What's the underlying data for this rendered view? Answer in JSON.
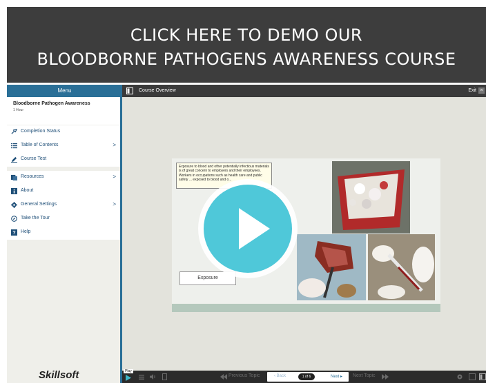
{
  "banner": {
    "line1": "CLICK HERE TO DEMO OUR",
    "line2": "BLOODBORNE PATHOGENS AWARENESS COURSE"
  },
  "sidebar": {
    "header": "Menu",
    "course_title": "Bloodborne Pathogen Awareness",
    "course_duration": "1 Hour",
    "items": [
      {
        "label": "Completion Status",
        "icon": "completion-status-icon"
      },
      {
        "label": "Table of Contents",
        "icon": "list-icon",
        "chevron": ">"
      },
      {
        "label": "Course Test",
        "icon": "pencil-icon"
      },
      {
        "label": "Resources",
        "icon": "resources-icon",
        "chevron": ">"
      },
      {
        "label": "About",
        "icon": "info-icon"
      },
      {
        "label": "General Settings",
        "icon": "gear-icon",
        "chevron": ">"
      },
      {
        "label": "Take the Tour",
        "icon": "compass-icon"
      },
      {
        "label": "Help",
        "icon": "help-icon"
      }
    ],
    "logo": "Skillsoft"
  },
  "topbar": {
    "title": "Course Overview",
    "exit": "Exit",
    "close": "×"
  },
  "slide": {
    "text": "Exposure to blood and other potentially infectious materials is of great concern to employers and their employees. Workers in occupations such as health care and public safety ... exposed to blood and o...",
    "button": "Exposure"
  },
  "bottombar": {
    "play_label": "Play",
    "previous_topic": "Previous Topic",
    "back": "Back",
    "page": "1 of 6",
    "next": "Next",
    "next_topic": "Next Topic"
  },
  "colors": {
    "accent": "#2a6f97",
    "play_button": "#4fc8d9"
  }
}
